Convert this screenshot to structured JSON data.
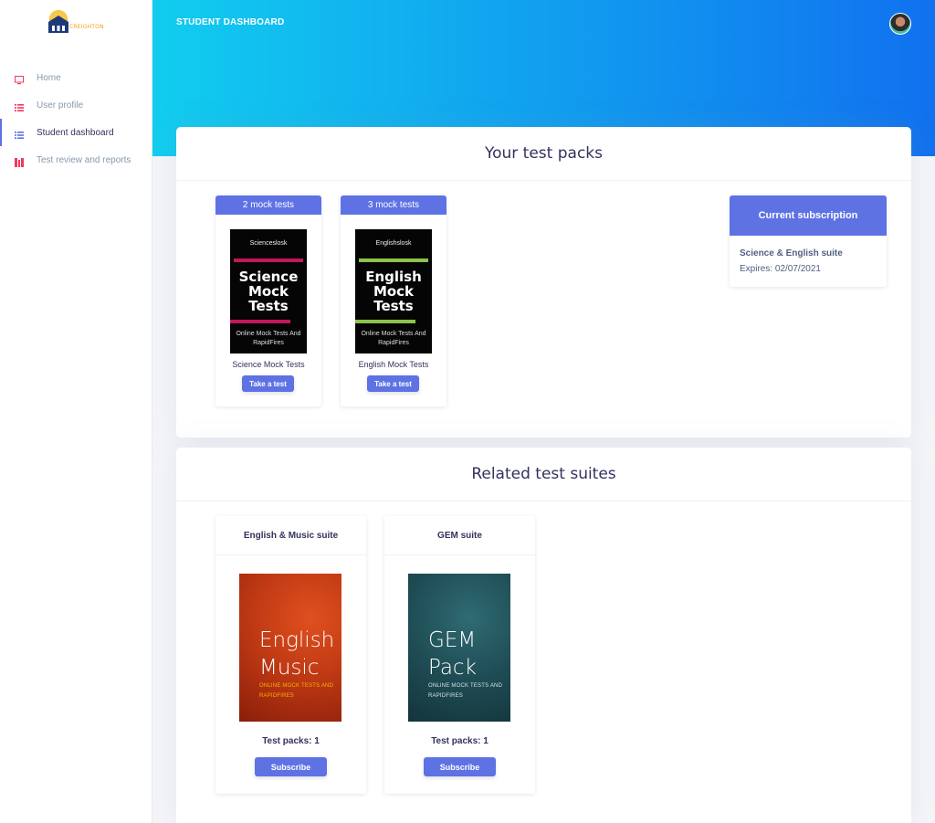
{
  "brand": {
    "logo_text": "CREIGHTON"
  },
  "sidebar": {
    "items": [
      {
        "label": "Home",
        "icon": "monitor-icon"
      },
      {
        "label": "User profile",
        "icon": "list-icon"
      },
      {
        "label": "Student dashboard",
        "icon": "list-icon",
        "active": true
      },
      {
        "label": "Test review and reports",
        "icon": "report-icon"
      }
    ]
  },
  "header": {
    "title": "STUDENT DASHBOARD"
  },
  "packs": {
    "title": "Your test packs",
    "items": [
      {
        "count": "2 mock tests",
        "cover_brand": "Scienceslosk",
        "cover_title": "Science Mock Tests",
        "cover_sub": "Online Mock Tests And RapidFires",
        "name": "Science Mock Tests",
        "button": "Take a test"
      },
      {
        "count": "3 mock tests",
        "cover_brand": "Englishslosk",
        "cover_title": "English Mock Tests",
        "cover_sub": "Online Mock Tests And RapidFires",
        "name": "English Mock Tests",
        "button": "Take a test"
      }
    ]
  },
  "subscription": {
    "heading": "Current subscription",
    "name": "Science & English suite",
    "expires": "Expires: 02/07/2021"
  },
  "suites": {
    "title": "Related test suites",
    "items": [
      {
        "name": "English & Music suite",
        "cover_title": "English Music",
        "cover_sub": "ONLINE MOCK TESTS AND RAPIDFIRES",
        "count": "Test packs: 1",
        "button": "Subscribe"
      },
      {
        "name": "GEM suite",
        "cover_title": "GEM Pack",
        "cover_sub": "ONLINE MOCK TESTS AND RAPIDFIRES",
        "count": "Test packs: 1",
        "button": "Subscribe"
      }
    ]
  },
  "colors": {
    "primary": "#5e72e4",
    "header_gradient_start": "#11cdef",
    "header_gradient_end": "#1171ef",
    "science_accent": "#c2185b",
    "english_accent": "#8bc34a"
  }
}
